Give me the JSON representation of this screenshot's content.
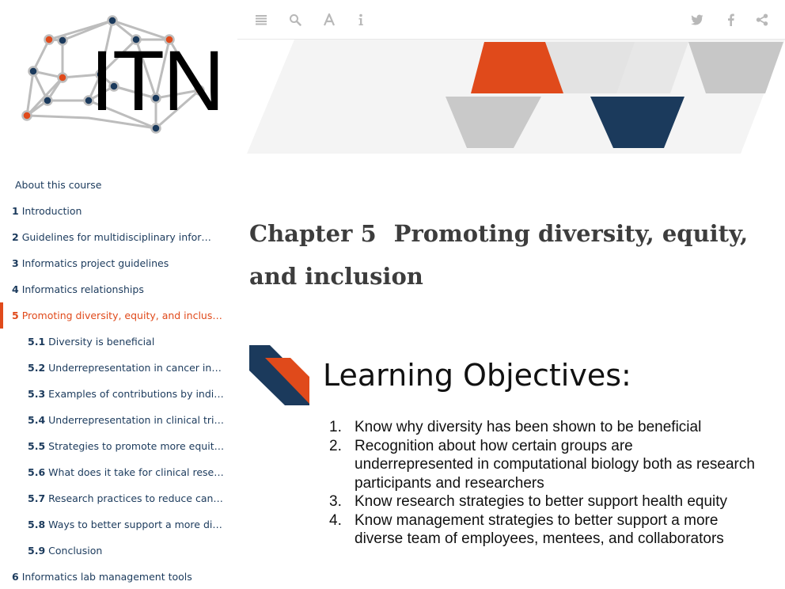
{
  "logo": {
    "text": "ITN"
  },
  "toolbar": {
    "left_icons": [
      "menu-icon",
      "search-icon",
      "font-icon",
      "info-icon"
    ],
    "right_icons": [
      "twitter-icon",
      "facebook-icon",
      "share-icon"
    ]
  },
  "toc": [
    {
      "num": "",
      "label": "About this course"
    },
    {
      "num": "1",
      "label": "Introduction"
    },
    {
      "num": "2",
      "label": "Guidelines for multidisciplinary infor…"
    },
    {
      "num": "3",
      "label": "Informatics project guidelines"
    },
    {
      "num": "4",
      "label": "Informatics relationships"
    },
    {
      "num": "5",
      "label": "Promoting diversity, equity, and inclus…"
    },
    {
      "num": "5.1",
      "label": "Diversity is beneficial"
    },
    {
      "num": "5.2",
      "label": "Underrepresentation in cancer inf…"
    },
    {
      "num": "5.3",
      "label": "Examples of contributions by indi…"
    },
    {
      "num": "5.4",
      "label": "Underrepresentation in clinical tri…"
    },
    {
      "num": "5.5",
      "label": "Strategies to promote more equit…"
    },
    {
      "num": "5.6",
      "label": "What does it take for clinical rese…"
    },
    {
      "num": "5.7",
      "label": "Research practices to reduce canc…"
    },
    {
      "num": "5.8",
      "label": "Ways to better support a more di…"
    },
    {
      "num": "5.9",
      "label": "Conclusion"
    },
    {
      "num": "6",
      "label": "Informatics lab management tools"
    }
  ],
  "chapter": {
    "number": "Chapter 5",
    "title": "Promoting diversity, equity, and inclusion"
  },
  "learning_objectives": {
    "heading": "Learning Objectives:",
    "items": [
      {
        "n": "1.",
        "text": "Know why diversity has been shown to be beneficial"
      },
      {
        "n": "2.",
        "text": "Recognition about how certain groups are underrepresented in computational biology both as research participants and researchers"
      },
      {
        "n": "3.",
        "text": "Know research strategies to better support health equity"
      },
      {
        "n": "4.",
        "text": "Know management strategies to better support a more diverse team of employees, mentees, and collaborators"
      }
    ]
  },
  "colors": {
    "accent": "#e04a1b",
    "navy": "#1b3a5c",
    "grey": "#cccccc"
  }
}
